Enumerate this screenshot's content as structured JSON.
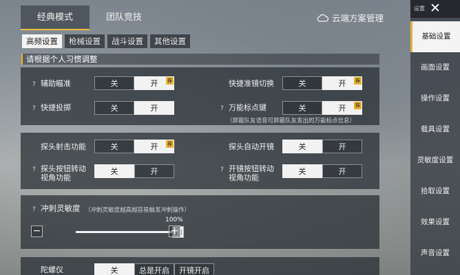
{
  "top_tabs": [
    {
      "label": "经典模式",
      "active": true
    },
    {
      "label": "团队竞技",
      "active": false
    }
  ],
  "cloud": {
    "label": "云端方案管理",
    "icon": "cloud-icon"
  },
  "sub_tabs": [
    {
      "label": "高频设置",
      "active": true
    },
    {
      "label": "枪械设置",
      "active": false
    },
    {
      "label": "战斗设置",
      "active": false
    },
    {
      "label": "其他设置",
      "active": false
    }
  ],
  "section_title": "请根据个人习惯调整",
  "help_glyph": "?",
  "recommend_badge": "荐",
  "settings": {
    "aim_assist": {
      "label": "辅助瞄准",
      "off": "关",
      "on": "开",
      "selected": "on",
      "recommended": true
    },
    "quick_throw": {
      "label": "快捷投掷",
      "off": "关",
      "on": "开",
      "selected": "on"
    },
    "quick_scope_switch": {
      "label": "快捷准镜切换",
      "off": "关",
      "on": "开",
      "selected": "on",
      "recommended": true
    },
    "universal_marker": {
      "label": "万能标点键",
      "off": "关",
      "on": "开",
      "selected": "on",
      "recommended": true,
      "note": "（屏蔽队友语音可屏蔽队友发出的万能标点信息）"
    },
    "peek_fire": {
      "label": "探头射击功能",
      "off": "关",
      "on": "开",
      "selected": "on",
      "recommended": true
    },
    "peek_auto_scope": {
      "label": "探头自动开镜",
      "off": "关",
      "on": "开",
      "selected": "off"
    },
    "peek_button_turn": {
      "label_line1": "探头按钮转动",
      "label_line2": "视角功能",
      "off": "关",
      "on": "开",
      "selected": "off"
    },
    "scope_button_turn": {
      "label_line1": "开镜按钮转动",
      "label_line2": "视角功能",
      "off": "关",
      "on": "开",
      "selected": "off"
    },
    "sprint_sensitivity": {
      "label": "冲刺灵敏度",
      "note": "（冲刺灵敏度越高越容易触发冲刺操作）",
      "value_text": "100%",
      "value": 1.0,
      "minus": "−",
      "plus": "+"
    },
    "gyroscope": {
      "label": "陀螺仪",
      "options": [
        "关",
        "总是开启",
        "开镜开启"
      ],
      "selected": 0
    }
  },
  "sidebar": {
    "title": "设置",
    "close": "✕",
    "items": [
      {
        "label": "基础设置",
        "active": true
      },
      {
        "label": "画面设置",
        "active": false
      },
      {
        "label": "操作设置",
        "active": false
      },
      {
        "label": "载具设置",
        "active": false
      },
      {
        "label": "灵敏度设置",
        "active": false
      },
      {
        "label": "拾取设置",
        "active": false
      },
      {
        "label": "效果设置",
        "active": false
      },
      {
        "label": "声音设置",
        "active": false
      }
    ]
  }
}
